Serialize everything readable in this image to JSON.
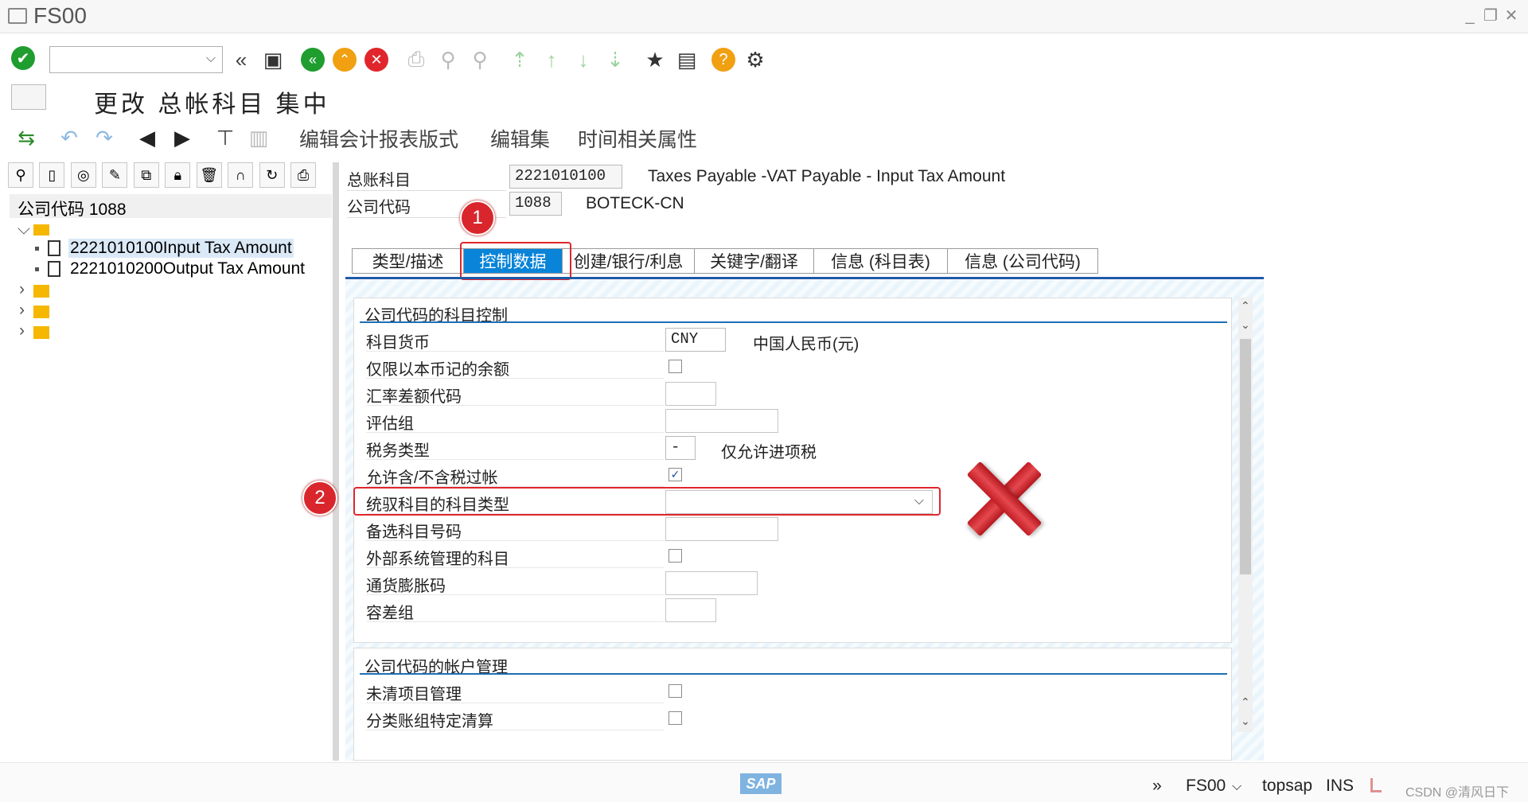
{
  "window": {
    "title": "FS00",
    "title_icon": "sap-window-icon"
  },
  "toolbar": {
    "command_field_value": "",
    "icons": [
      "enter-icon",
      "back-double-icon",
      "save-icon",
      "back-icon",
      "exit-icon",
      "cancel-icon",
      "print-icon",
      "find-icon",
      "find-next-icon",
      "first-page-icon",
      "previous-page-icon",
      "next-page-icon",
      "last-page-icon",
      "create-session-icon",
      "shortcut-icon",
      "help-icon",
      "settings-icon"
    ]
  },
  "page": {
    "title": "更改 总帐科目 集中"
  },
  "app_toolbar": {
    "menu_items": [
      "编辑会计报表版式",
      "编辑集",
      "时间相关属性"
    ]
  },
  "left": {
    "company_code_row": "公司代码 1088",
    "tree": [
      {
        "label": "2221010100Input Tax Amount",
        "selected": true
      },
      {
        "label": "2221010200Output Tax Amount",
        "selected": false
      }
    ]
  },
  "header": {
    "gl_account_label": "总账科目",
    "gl_account_value": "2221010100",
    "gl_account_desc": "Taxes Payable -VAT Payable - Input Tax Amount",
    "company_code_label": "公司代码",
    "company_code_value": "1088",
    "company_code_desc": "BOTECK-CN"
  },
  "tabs": [
    {
      "label": "类型/描述",
      "active": false
    },
    {
      "label": "控制数据",
      "active": true
    },
    {
      "label": "创建/银行/利息",
      "active": false
    },
    {
      "label": "关键字/翻译",
      "active": false
    },
    {
      "label": "信息 (科目表)",
      "active": false
    },
    {
      "label": "信息 (公司代码)",
      "active": false
    }
  ],
  "group1": {
    "title": "公司代码的科目控制",
    "rows": {
      "currency": {
        "label": "科目货币",
        "value": "CNY",
        "desc": "中国人民币(元)"
      },
      "local_only": {
        "label": "仅限以本币记的余额",
        "checked": false
      },
      "exch_diff": {
        "label": "汇率差额代码",
        "value": ""
      },
      "valuation": {
        "label": "评估组",
        "value": ""
      },
      "tax_cat": {
        "label": "税务类型",
        "value": "-",
        "desc": "仅允许进项税"
      },
      "posting_wo_tax": {
        "label": "允许含/不含税过帐",
        "checked": true
      },
      "recon": {
        "label": "统驭科目的科目类型",
        "value": ""
      },
      "alt_acct": {
        "label": "备选科目号码",
        "value": ""
      },
      "ext_mgmt": {
        "label": "外部系统管理的科目",
        "checked": false
      },
      "inflation": {
        "label": "通货膨胀码",
        "value": ""
      },
      "tolerance": {
        "label": "容差组",
        "value": ""
      }
    }
  },
  "group2": {
    "title": "公司代码的帐户管理",
    "rows": {
      "open_item": {
        "label": "未清项目管理",
        "checked": false
      },
      "ledger_group": {
        "label": "分类账组特定清算",
        "checked": false
      }
    }
  },
  "annotations": {
    "marker1": "1",
    "marker2": "2"
  },
  "status": {
    "transaction": "FS00",
    "server": "topsap",
    "mode": "INS",
    "logo_text": "SAP",
    "watermark": "CSDN @清风日下"
  },
  "colors": {
    "accent": "#0a84d8",
    "highlight": "#e0262c"
  }
}
